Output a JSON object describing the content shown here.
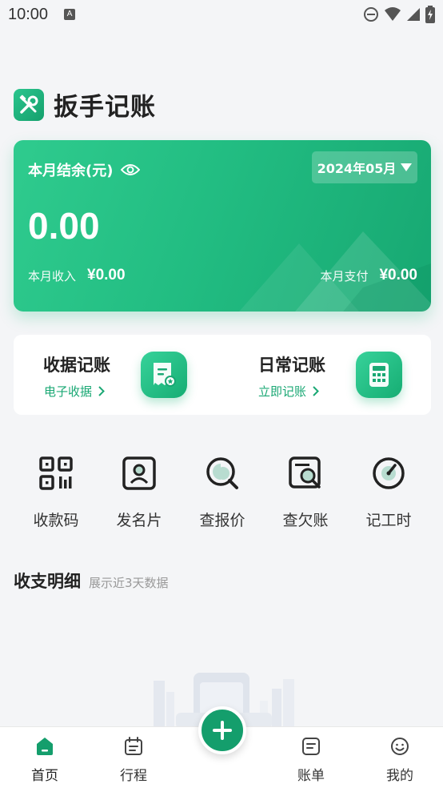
{
  "status_bar": {
    "time": "10:00",
    "notification_badge": "A"
  },
  "header": {
    "title": "扳手记账"
  },
  "balance_card": {
    "label": "本月结余(元)",
    "month": "2024年05月",
    "amount": "0.00",
    "income_label": "本月收入",
    "income_value": "¥0.00",
    "expense_label": "本月支付",
    "expense_value": "¥0.00"
  },
  "quick_entries": [
    {
      "title": "收据记账",
      "sub": "电子收据",
      "icon": "receipt-icon"
    },
    {
      "title": "日常记账",
      "sub": "立即记账",
      "icon": "calculator-icon"
    }
  ],
  "tools": [
    {
      "label": "收款码",
      "icon": "qr-code-icon"
    },
    {
      "label": "发名片",
      "icon": "business-card-icon"
    },
    {
      "label": "查报价",
      "icon": "price-search-icon"
    },
    {
      "label": "查欠账",
      "icon": "debt-search-icon"
    },
    {
      "label": "记工时",
      "icon": "timer-icon"
    }
  ],
  "details": {
    "title": "收支明细",
    "hint": "展示近3天数据"
  },
  "bottom_nav": [
    {
      "label": "首页",
      "icon": "home-icon",
      "active": true
    },
    {
      "label": "行程",
      "icon": "calendar-icon",
      "active": false
    },
    {
      "label": "账单",
      "icon": "bill-icon",
      "active": false
    },
    {
      "label": "我的",
      "icon": "smile-icon",
      "active": false
    }
  ],
  "colors": {
    "accent": "#1aa874",
    "card_start": "#2fcb8e",
    "card_end": "#17a872",
    "fab": "#149e6c"
  }
}
